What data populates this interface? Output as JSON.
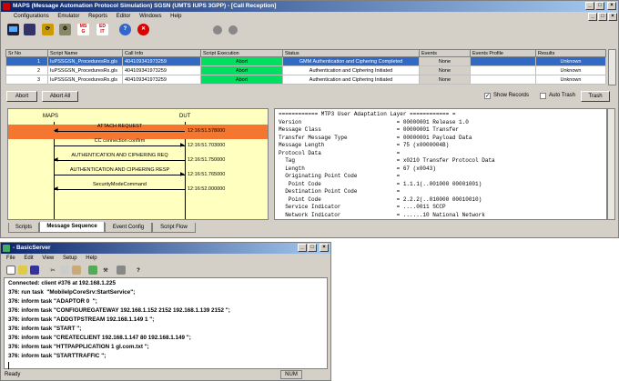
{
  "main": {
    "title": "MAPS (Message Automation Protocol Simulation) SGSN (UMTS IUPS 3GPP) - [Call Reception]",
    "menu": [
      "Configurations",
      "Emulator",
      "Reports",
      "Editor",
      "Windows",
      "Help"
    ],
    "toolbar_icons": [
      "display-icon",
      "book-icon",
      "sync-icon",
      "tools-icon",
      "msg-icon",
      "edit-icon",
      "help-icon",
      "stop-icon",
      "record-icon",
      "pause-icon"
    ],
    "table": {
      "headers": [
        "Sr No",
        "Script Name",
        "Call Info",
        "Script Execution",
        "Status",
        "Events",
        "Events Profile",
        "Results"
      ],
      "rows": [
        [
          "1",
          "IuPSSGSN_ProceduresRx.gls",
          "404109341973259",
          "Abort",
          "GMM Authentication and Ciphering Completed",
          "None",
          "",
          "Unknown"
        ],
        [
          "2",
          "IuPSSGSN_ProceduresRx.gls",
          "404109341973259",
          "Abort",
          "Authentication and Ciphering Initiated",
          "None",
          "",
          "Unknown"
        ],
        [
          "3",
          "IuPSSGSN_ProceduresRx.gls",
          "404109341973259",
          "Abort",
          "Authentication and Ciphering Initiated",
          "None",
          "",
          "Unknown"
        ]
      ]
    },
    "buttons": {
      "abort": "Abort",
      "abort_all": "Abort All",
      "trash": "Trash"
    },
    "checkboxes": {
      "show_records": "Show Records",
      "auto_trash": "Auto Trash"
    },
    "sequence": {
      "left": "MAPS",
      "right": "DUT",
      "messages": [
        {
          "label": "ATTACH REQUEST",
          "time": "12:16:51.578000"
        },
        {
          "label": "CC connection confirm",
          "time": "12:16:51.703000"
        },
        {
          "label": "AUTHENTICATION AND CIPHERING REQ",
          "time": "12:16:51.750000"
        },
        {
          "label": "AUTHENTICATION AND CIPHERING RESP",
          "time": "12:16:51.765000"
        },
        {
          "label": "SecurityModeCommand",
          "time": "12:16:52.000000"
        }
      ]
    },
    "decode": [
      "============ MTP3 User Adaptation Layer ============ =",
      "Version                             = 00000001 Release 1.0",
      "Message Class                       = 00000001 Transfer",
      "Transfer Message Type               = 00000001 Payload Data",
      "Message Length                      = 75 (x0000004B)",
      "Protocol Data                       =",
      "  Tag                               = x0210 Transfer Protocol Data",
      "  Length                            = 67 (x0043)",
      "  Originating Point Code            =",
      "   Point Code                       = 1.1.1(..001000 00001001)",
      "  Destination Point Code            =",
      "   Point Code                       = 2.2.2(..010000 00010010)",
      "  Service Indicator                 = ....0011 SCCP",
      "  Network Indicator                 = ......10 National Network"
    ],
    "tabs": [
      "Scripts",
      "Message Sequence",
      "Event Config",
      "Script Flow"
    ]
  },
  "server": {
    "title": "- BasicServer",
    "menu": [
      "File",
      "Edit",
      "View",
      "Setup",
      "Help"
    ],
    "lines": [
      "Connected: client #376 at 192.168.1.225",
      "376: run task  \"MobileIpCoreSrv:StartService\";",
      "376: inform task \"ADAPTOR 0  \";",
      "376: inform task \"CONFIGUREGATEWAY 192.168.1.152 2152 192.168.1.139 2152 \";",
      "376: inform task \"ADDGTPSTREAM 192.168.1.149 1 \";",
      "376: inform task \"START \";",
      "376: inform task \"CREATECLIENT 192.168.1.147 80 192.168.1.149 \";",
      "376: inform task \"HTTPAPPLICATION 1 gl.com.txt \";",
      "376: inform task \"STARTTRAFFIC \";"
    ],
    "status": "Ready",
    "num": "NUM"
  }
}
